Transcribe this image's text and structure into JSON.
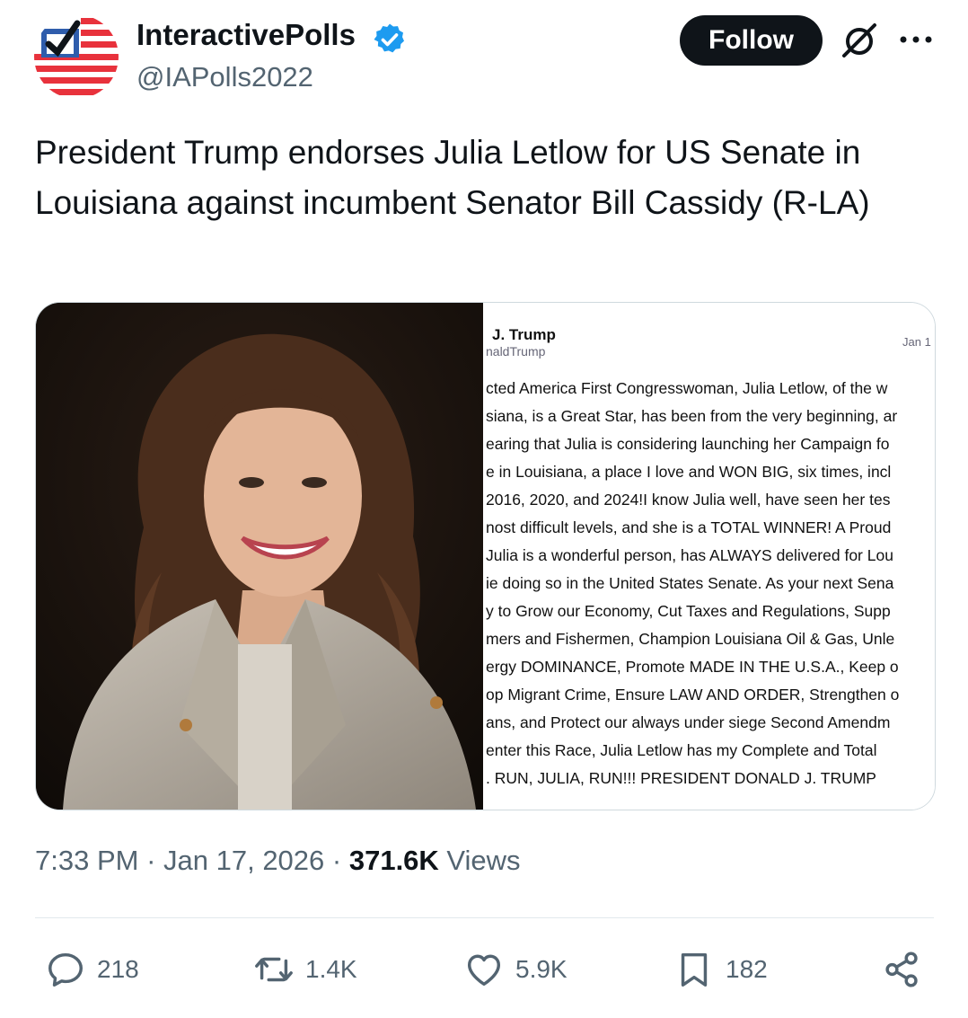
{
  "author": {
    "display_name": "InteractivePolls",
    "handle": "@IAPolls2022",
    "verified_color": "#1d9bf0",
    "avatar_icon": "checkmark-flag-logo"
  },
  "header": {
    "follow_label": "Follow",
    "grok_icon": "grok-icon",
    "more_icon": "more-dots-icon"
  },
  "tweet": {
    "text": "President Trump endorses Julia Letlow for US Senate in Louisiana against incumbent Senator Bill Cassidy (R-LA)"
  },
  "media": {
    "photo_description_icon": "portrait-photo",
    "post": {
      "name": "J. Trump",
      "handle": "naldTrump",
      "date": "Jan 1",
      "lines": [
        "cted America First Congresswoman, Julia Letlow, of the w",
        "siana, is a Great Star, has been from the very beginning, ar",
        "earing that Julia is considering launching her Campaign fo",
        "e in Louisiana, a place I love and WON BIG, six times, incl",
        "2016, 2020, and 2024!I know Julia well, have seen her tes",
        "nost difficult levels, and she is a TOTAL WINNER! A Proud",
        "Julia is a wonderful person, has ALWAYS delivered for Lou",
        "ie doing so in the United States Senate. As your next Sena",
        "y to Grow our Economy, Cut Taxes and Regulations, Supp",
        "mers and Fishermen, Champion Louisiana Oil & Gas, Unle",
        "ergy DOMINANCE, Promote MADE IN THE U.S.A., Keep o",
        "op Migrant Crime, Ensure LAW AND ORDER, Strengthen o",
        "ans, and Protect our always under siege Second Amendm",
        " enter this Race, Julia Letlow has my Complete and Total",
        ". RUN, JULIA, RUN!!! PRESIDENT DONALD J. TRUMP"
      ]
    }
  },
  "meta": {
    "time": "7:33 PM",
    "separator": " · ",
    "date": "Jan 17, 2026",
    "views_count": "371.6K",
    "views_label": " Views"
  },
  "actions": {
    "replies": "218",
    "reposts": "1.4K",
    "likes": "5.9K",
    "bookmarks": "182"
  },
  "colors": {
    "text": "#0f1419",
    "secondary": "#536471",
    "accent": "#1d9bf0",
    "button_bg": "#0f1419"
  }
}
